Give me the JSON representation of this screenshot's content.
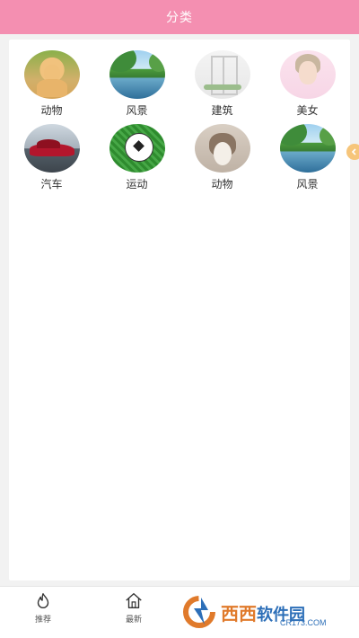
{
  "header": {
    "title": "分类"
  },
  "categories": [
    {
      "label": "动物",
      "thumb": "puppy-photo"
    },
    {
      "label": "风景",
      "thumb": "lake-landscape-photo"
    },
    {
      "label": "建筑",
      "thumb": "window-interior-photo"
    },
    {
      "label": "美女",
      "thumb": "portrait-photo"
    },
    {
      "label": "汽车",
      "thumb": "red-sports-car-photo"
    },
    {
      "label": "运动",
      "thumb": "soccer-ball-photo"
    },
    {
      "label": "动物",
      "thumb": "cat-photo"
    },
    {
      "label": "风景",
      "thumb": "lake-landscape-photo"
    }
  ],
  "tabbar": {
    "tabs": [
      {
        "label": "推荐",
        "icon": "flame-icon"
      },
      {
        "label": "最新",
        "icon": "home-icon"
      }
    ]
  },
  "watermark": {
    "brand_a": "西西",
    "brand_b": "软件园",
    "url": "CR173.COM"
  },
  "colors": {
    "header_bg": "#f48fb1",
    "page_bg": "#f2f2f2",
    "accent_handle": "#f6c57a",
    "watermark_orange": "#e07a2b",
    "watermark_blue": "#2d6fb8"
  }
}
